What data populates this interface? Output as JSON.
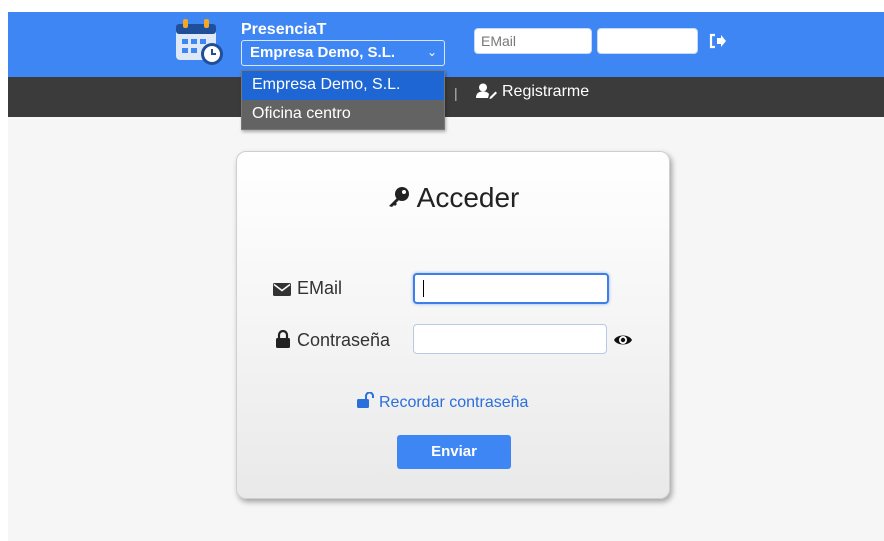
{
  "header": {
    "app_name": "PresenciaT",
    "company_selected": "Empresa Demo, S.L.",
    "email_placeholder": "EMail",
    "password_value": "",
    "logout_icon": "sign-out-icon"
  },
  "company_dropdown": {
    "options": [
      "Empresa Demo, S.L.",
      "Oficina centro"
    ]
  },
  "nav": {
    "separator": "|",
    "register_label": "Registrarme"
  },
  "login": {
    "title": "Acceder",
    "email_label": "EMail",
    "email_value": "",
    "password_label": "Contraseña",
    "password_value": "",
    "forgot_link": "Recordar contraseña",
    "submit_label": "Enviar"
  },
  "colors": {
    "brand_blue": "#3f86f5",
    "nav_dark": "#3b3b3b",
    "link_blue": "#2a6fdb",
    "dropdown_selected": "#1e66d3",
    "dropdown_other": "#636363"
  }
}
